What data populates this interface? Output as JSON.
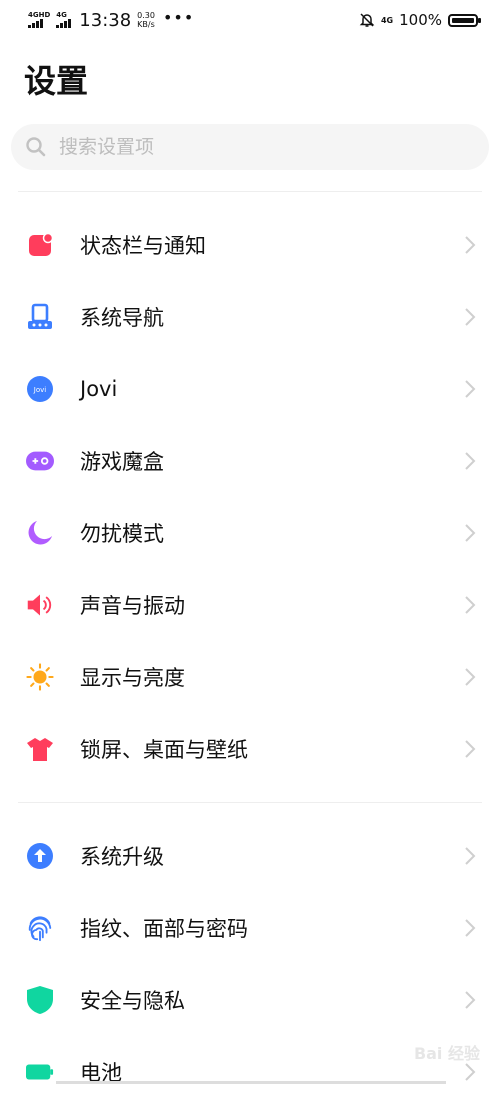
{
  "status_bar": {
    "sim1": "4GHD",
    "sim2": "4G",
    "time": "13:38",
    "speed_value": "0.30",
    "speed_unit": "KB/s",
    "dots": "•••",
    "network_right": "4G",
    "battery": "100%"
  },
  "page_title": "设置",
  "search": {
    "placeholder": "搜索设置项"
  },
  "group1": [
    {
      "label": "状态栏与通知",
      "icon": "status-bar-notification-icon",
      "color": "#ff3d5c"
    },
    {
      "label": "系统导航",
      "icon": "system-navigation-icon",
      "color": "#3d7eff"
    },
    {
      "label": "Jovi",
      "icon": "jovi-icon",
      "color": "#3d7eff"
    },
    {
      "label": "游戏魔盒",
      "icon": "game-box-icon",
      "color": "#a35bff"
    },
    {
      "label": "勿扰模式",
      "icon": "moon-icon",
      "color": "#b15cff"
    },
    {
      "label": "声音与振动",
      "icon": "speaker-icon",
      "color": "#ff3d5c"
    },
    {
      "label": "显示与亮度",
      "icon": "sun-icon",
      "color": "#ffa81a"
    },
    {
      "label": "锁屏、桌面与壁纸",
      "icon": "tshirt-icon",
      "color": "#ff3d5c"
    }
  ],
  "group2": [
    {
      "label": "系统升级",
      "icon": "upgrade-arrow-icon",
      "color": "#3d7eff"
    },
    {
      "label": "指纹、面部与密码",
      "icon": "fingerprint-icon",
      "color": "#3d7eff"
    },
    {
      "label": "安全与隐私",
      "icon": "shield-icon",
      "color": "#10d6a0"
    },
    {
      "label": "电池",
      "icon": "battery-icon",
      "color": "#10d6a0"
    }
  ],
  "watermark": "Bai 经验"
}
